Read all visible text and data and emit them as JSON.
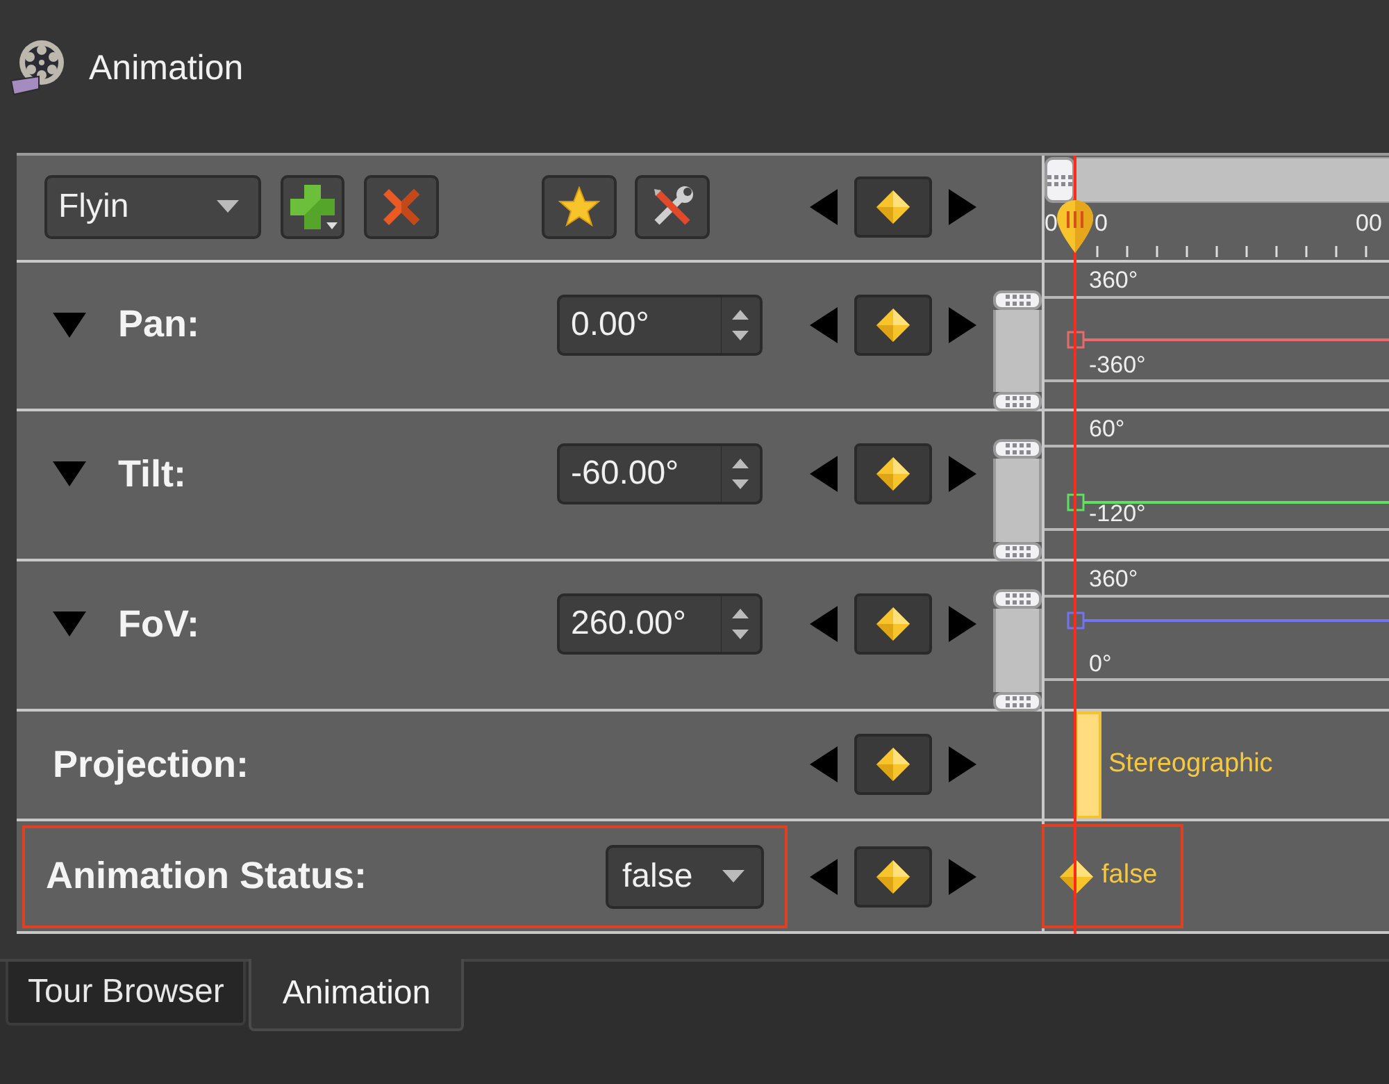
{
  "window": {
    "title": "Animation"
  },
  "toolbar": {
    "preset": "Flyin"
  },
  "ruler": {
    "labels": [
      "0",
      "0",
      "00"
    ]
  },
  "rows": [
    {
      "kind": "numeric",
      "label": "Pan:",
      "expanded": true,
      "value": "0.00°",
      "max_label": "360°",
      "min_label": "-360°",
      "color": "#e86a6a",
      "highlighted": false
    },
    {
      "kind": "numeric",
      "label": "Tilt:",
      "expanded": true,
      "value": "-60.00°",
      "max_label": "60°",
      "min_label": "-120°",
      "color": "#5fe05f",
      "highlighted": false
    },
    {
      "kind": "numeric",
      "label": "FoV:",
      "expanded": true,
      "value": "260.00°",
      "max_label": "360°",
      "min_label": "0°",
      "color": "#7474f0",
      "highlighted": false
    },
    {
      "kind": "segment",
      "label": "Projection:",
      "segment": "Stereographic",
      "highlighted": false
    },
    {
      "kind": "choice",
      "label": "Animation Status:",
      "value": "false",
      "key_label": "false",
      "highlighted": true
    }
  ],
  "tabs": [
    {
      "label": "Tour Browser",
      "selected": false
    },
    {
      "label": "Animation",
      "selected": true
    }
  ]
}
